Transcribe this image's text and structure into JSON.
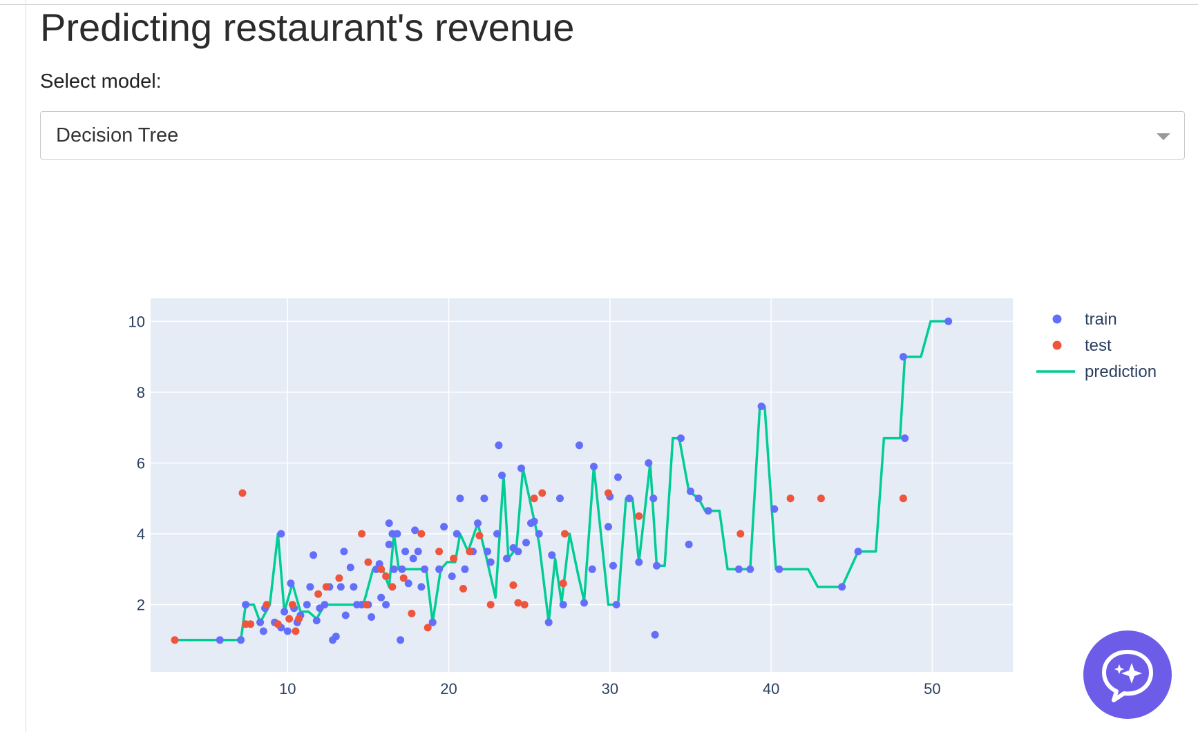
{
  "page": {
    "title": "Predicting restaurant's revenue",
    "select_label": "Select model:",
    "model_select": {
      "selected": "Decision Tree"
    }
  },
  "chat_button": {
    "icon": "chat-sparkle-icon",
    "color": "#6c5ce7"
  },
  "chart_data": {
    "type": "scatter",
    "title": "",
    "xlabel": "",
    "ylabel": "",
    "xlim": [
      1.5,
      55
    ],
    "ylim": [
      0.1,
      10.65
    ],
    "xticks": [
      10,
      20,
      30,
      40,
      50
    ],
    "yticks": [
      2,
      4,
      6,
      8,
      10
    ],
    "grid": true,
    "legend_position": "top-right",
    "colors": {
      "background": "#e5ecf6",
      "grid": "#ffffff",
      "train": "#636efa",
      "test": "#ef553b",
      "prediction": "#00cc96"
    },
    "series": [
      {
        "name": "train",
        "mode": "markers",
        "points": [
          [
            5.8,
            1.0
          ],
          [
            7.1,
            1.0
          ],
          [
            7.4,
            2.0
          ],
          [
            8.3,
            1.5
          ],
          [
            8.5,
            1.25
          ],
          [
            8.6,
            1.9
          ],
          [
            9.2,
            1.5
          ],
          [
            9.6,
            4.0
          ],
          [
            9.6,
            1.35
          ],
          [
            9.8,
            1.8
          ],
          [
            10.0,
            1.25
          ],
          [
            10.2,
            2.6
          ],
          [
            10.4,
            1.9
          ],
          [
            10.6,
            1.5
          ],
          [
            10.8,
            1.7
          ],
          [
            11.2,
            2.0
          ],
          [
            11.4,
            2.5
          ],
          [
            11.6,
            3.4
          ],
          [
            11.8,
            1.55
          ],
          [
            12.0,
            1.9
          ],
          [
            12.3,
            2.0
          ],
          [
            12.6,
            2.5
          ],
          [
            12.8,
            1.0
          ],
          [
            13.0,
            1.1
          ],
          [
            13.3,
            2.5
          ],
          [
            13.5,
            3.5
          ],
          [
            13.6,
            1.7
          ],
          [
            13.9,
            3.05
          ],
          [
            14.1,
            2.5
          ],
          [
            14.3,
            2.0
          ],
          [
            14.6,
            2.0
          ],
          [
            15.0,
            2.0
          ],
          [
            15.2,
            1.65
          ],
          [
            15.5,
            3.0
          ],
          [
            15.7,
            3.15
          ],
          [
            15.8,
            2.2
          ],
          [
            16.1,
            2.0
          ],
          [
            16.3,
            3.7
          ],
          [
            16.3,
            4.3
          ],
          [
            16.5,
            4.0
          ],
          [
            16.6,
            3.0
          ],
          [
            16.8,
            4.0
          ],
          [
            17.0,
            1.0
          ],
          [
            17.1,
            3.0
          ],
          [
            17.3,
            3.5
          ],
          [
            17.5,
            2.6
          ],
          [
            17.8,
            3.3
          ],
          [
            17.9,
            4.1
          ],
          [
            18.1,
            3.5
          ],
          [
            18.3,
            2.5
          ],
          [
            18.5,
            3.0
          ],
          [
            19.0,
            1.5
          ],
          [
            19.4,
            3.0
          ],
          [
            19.7,
            4.2
          ],
          [
            20.2,
            2.8
          ],
          [
            20.5,
            4.0
          ],
          [
            20.7,
            5.0
          ],
          [
            21.0,
            3.0
          ],
          [
            21.5,
            3.5
          ],
          [
            21.8,
            4.3
          ],
          [
            22.2,
            5.0
          ],
          [
            22.4,
            3.5
          ],
          [
            22.6,
            3.2
          ],
          [
            23.0,
            4.0
          ],
          [
            23.1,
            6.5
          ],
          [
            23.3,
            5.65
          ],
          [
            23.6,
            3.3
          ],
          [
            24.0,
            3.6
          ],
          [
            24.3,
            3.5
          ],
          [
            24.5,
            5.85
          ],
          [
            24.8,
            3.75
          ],
          [
            25.1,
            4.3
          ],
          [
            25.3,
            4.35
          ],
          [
            25.6,
            4.0
          ],
          [
            26.2,
            1.5
          ],
          [
            26.4,
            3.4
          ],
          [
            26.9,
            5.0
          ],
          [
            27.1,
            2.0
          ],
          [
            28.1,
            6.5
          ],
          [
            28.4,
            2.05
          ],
          [
            28.9,
            3.0
          ],
          [
            29.0,
            5.9
          ],
          [
            29.9,
            4.2
          ],
          [
            30.0,
            5.05
          ],
          [
            30.2,
            3.1
          ],
          [
            30.4,
            2.0
          ],
          [
            30.5,
            5.6
          ],
          [
            31.2,
            5.0
          ],
          [
            31.8,
            3.2
          ],
          [
            32.4,
            6.0
          ],
          [
            32.7,
            5.0
          ],
          [
            32.8,
            1.15
          ],
          [
            32.9,
            3.1
          ],
          [
            34.4,
            6.7
          ],
          [
            34.9,
            3.7
          ],
          [
            35.0,
            5.2
          ],
          [
            35.5,
            5.0
          ],
          [
            36.1,
            4.65
          ],
          [
            38.0,
            3.0
          ],
          [
            38.7,
            3.0
          ],
          [
            39.4,
            7.6
          ],
          [
            40.2,
            4.7
          ],
          [
            40.5,
            3.0
          ],
          [
            44.4,
            2.5
          ],
          [
            45.4,
            3.5
          ],
          [
            48.2,
            9.0
          ],
          [
            48.3,
            6.7
          ],
          [
            51.0,
            10.0
          ]
        ]
      },
      {
        "name": "test",
        "mode": "markers",
        "points": [
          [
            3.0,
            1.0
          ],
          [
            7.2,
            5.15
          ],
          [
            7.4,
            1.45
          ],
          [
            7.7,
            1.45
          ],
          [
            8.7,
            2.0
          ],
          [
            9.4,
            1.45
          ],
          [
            10.1,
            1.6
          ],
          [
            10.3,
            2.0
          ],
          [
            10.5,
            1.25
          ],
          [
            10.7,
            1.6
          ],
          [
            11.9,
            2.3
          ],
          [
            12.4,
            2.5
          ],
          [
            13.2,
            2.75
          ],
          [
            14.6,
            4.0
          ],
          [
            14.9,
            2.0
          ],
          [
            15.0,
            3.2
          ],
          [
            15.8,
            3.0
          ],
          [
            16.1,
            2.8
          ],
          [
            16.5,
            2.5
          ],
          [
            17.2,
            2.75
          ],
          [
            17.7,
            1.75
          ],
          [
            18.3,
            4.0
          ],
          [
            18.7,
            1.35
          ],
          [
            19.4,
            3.5
          ],
          [
            20.3,
            3.3
          ],
          [
            20.9,
            2.45
          ],
          [
            21.3,
            3.5
          ],
          [
            21.9,
            3.95
          ],
          [
            22.6,
            2.0
          ],
          [
            24.0,
            2.55
          ],
          [
            24.3,
            2.05
          ],
          [
            24.7,
            2.0
          ],
          [
            25.3,
            5.0
          ],
          [
            25.8,
            5.15
          ],
          [
            27.2,
            4.0
          ],
          [
            27.1,
            2.6
          ],
          [
            29.9,
            5.15
          ],
          [
            31.8,
            4.5
          ],
          [
            38.1,
            4.0
          ],
          [
            41.2,
            5.0
          ],
          [
            43.1,
            5.0
          ],
          [
            48.2,
            5.0
          ]
        ]
      },
      {
        "name": "prediction",
        "mode": "lines",
        "points": [
          [
            3.0,
            1.0
          ],
          [
            5.8,
            1.0
          ],
          [
            7.1,
            1.0
          ],
          [
            7.4,
            2.0
          ],
          [
            7.9,
            2.0
          ],
          [
            8.3,
            1.5
          ],
          [
            8.9,
            2.0
          ],
          [
            9.4,
            4.0
          ],
          [
            9.8,
            1.8
          ],
          [
            10.3,
            2.6
          ],
          [
            10.8,
            1.8
          ],
          [
            11.3,
            1.8
          ],
          [
            11.8,
            1.6
          ],
          [
            12.3,
            2.0
          ],
          [
            13.0,
            2.0
          ],
          [
            13.8,
            2.0
          ],
          [
            14.7,
            2.0
          ],
          [
            15.3,
            3.0
          ],
          [
            15.9,
            3.0
          ],
          [
            16.3,
            2.5
          ],
          [
            16.6,
            4.0
          ],
          [
            16.9,
            3.0
          ],
          [
            17.8,
            3.0
          ],
          [
            18.6,
            3.0
          ],
          [
            19.0,
            1.5
          ],
          [
            19.5,
            3.0
          ],
          [
            19.9,
            3.2
          ],
          [
            20.4,
            3.2
          ],
          [
            20.7,
            4.0
          ],
          [
            21.2,
            3.5
          ],
          [
            21.8,
            4.3
          ],
          [
            22.3,
            3.4
          ],
          [
            22.9,
            2.2
          ],
          [
            23.4,
            5.65
          ],
          [
            23.7,
            3.3
          ],
          [
            24.2,
            3.6
          ],
          [
            24.6,
            5.85
          ],
          [
            25.6,
            3.75
          ],
          [
            26.2,
            1.5
          ],
          [
            26.6,
            3.3
          ],
          [
            27.0,
            2.05
          ],
          [
            27.5,
            4.0
          ],
          [
            28.0,
            2.9
          ],
          [
            28.4,
            2.1
          ],
          [
            29.0,
            5.9
          ],
          [
            29.9,
            2.0
          ],
          [
            30.5,
            2.0
          ],
          [
            31.0,
            5.0
          ],
          [
            31.4,
            5.0
          ],
          [
            31.8,
            3.2
          ],
          [
            32.5,
            6.0
          ],
          [
            32.9,
            3.1
          ],
          [
            33.4,
            3.1
          ],
          [
            33.9,
            6.7
          ],
          [
            34.3,
            6.7
          ],
          [
            34.9,
            5.2
          ],
          [
            35.5,
            5.0
          ],
          [
            35.9,
            4.65
          ],
          [
            36.8,
            4.65
          ],
          [
            37.3,
            3.0
          ],
          [
            38.7,
            3.0
          ],
          [
            39.3,
            7.6
          ],
          [
            39.6,
            7.6
          ],
          [
            40.3,
            3.0
          ],
          [
            41.0,
            3.0
          ],
          [
            42.3,
            3.0
          ],
          [
            42.9,
            2.5
          ],
          [
            44.4,
            2.5
          ],
          [
            45.4,
            3.5
          ],
          [
            46.5,
            3.5
          ],
          [
            47.0,
            6.7
          ],
          [
            48.0,
            6.7
          ],
          [
            48.3,
            9.0
          ],
          [
            49.3,
            9.0
          ],
          [
            49.9,
            10.0
          ],
          [
            51.0,
            10.0
          ]
        ]
      }
    ]
  }
}
